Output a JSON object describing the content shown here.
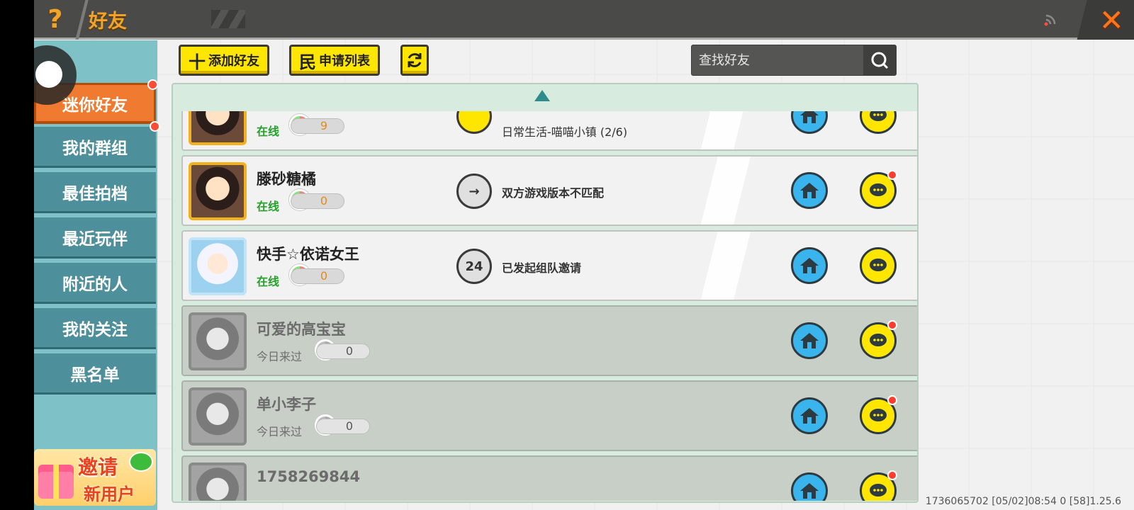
{
  "header": {
    "help_icon": "question-mark-icon",
    "help_glyph": "?",
    "title": "好友",
    "close_glyph": "✕",
    "accent_color": "#f2a42a"
  },
  "sidebar": {
    "tabs": [
      {
        "label": "迷你好友",
        "active": true,
        "dot": true
      },
      {
        "label": "我的群组",
        "active": false,
        "dot": true
      },
      {
        "label": "最佳拍档",
        "active": false,
        "dot": false
      },
      {
        "label": "最近玩伴",
        "active": false,
        "dot": false
      },
      {
        "label": "附近的人",
        "active": false,
        "dot": false
      },
      {
        "label": "我的关注",
        "active": false,
        "dot": false
      },
      {
        "label": "黑名单",
        "active": false,
        "dot": false
      }
    ],
    "invite": {
      "line1": "邀请",
      "line2": "新用户"
    }
  },
  "toolbar": {
    "add_friend": {
      "icon": "十",
      "label": "添加好友"
    },
    "request_list": {
      "icon": "民",
      "label": "申请列表"
    },
    "refresh_icon": "refresh-icon",
    "search_placeholder": "查找好友"
  },
  "friends": [
    {
      "nickname": "",
      "status": "在线",
      "likes": "9",
      "activity_badge": "",
      "activity": "日常生活-喵喵小镇 (2/6)",
      "chat_badge": false,
      "offline": false
    },
    {
      "nickname": "滕砂糖橘",
      "status": "在线",
      "likes": "0",
      "activity_badge": "→",
      "activity": "双方游戏版本不匹配",
      "chat_badge": true,
      "offline": false
    },
    {
      "nickname": "快手☆依诺女王",
      "status": "在线",
      "likes": "0",
      "activity_badge": "24",
      "activity": "已发起组队邀请",
      "chat_badge": false,
      "offline": false
    },
    {
      "nickname": "可爱的高宝宝",
      "status": "今日来过",
      "likes": "0",
      "activity_badge": "",
      "activity": "",
      "chat_badge": true,
      "offline": true
    },
    {
      "nickname": "单小李子",
      "status": "今日来过",
      "likes": "0",
      "activity_badge": "",
      "activity": "",
      "chat_badge": true,
      "offline": true
    },
    {
      "nickname": "1758269844",
      "status": "",
      "likes": "",
      "activity_badge": "",
      "activity": "",
      "chat_badge": true,
      "offline": true
    }
  ],
  "footer": {
    "info": "1736065702   [05/02]08:54 0   [58]1.25.6"
  }
}
